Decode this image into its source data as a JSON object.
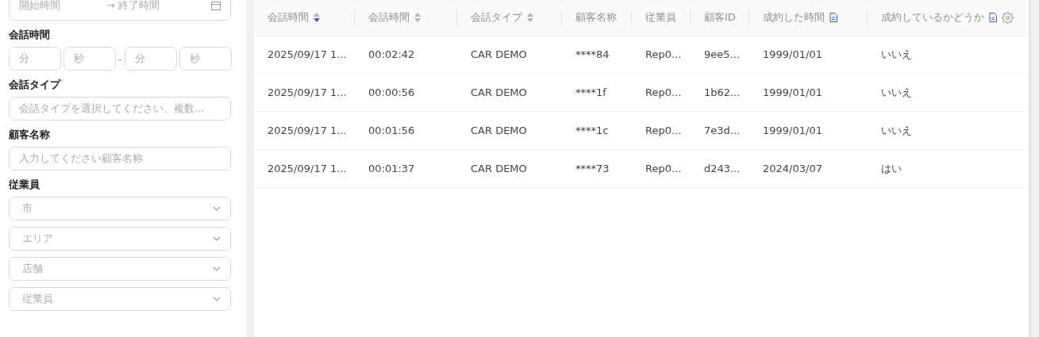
{
  "filters": [
    {
      "kind": "range",
      "start_placeholder": "開始時間",
      "end_placeholder": "終了時間",
      "separator": "→"
    },
    {
      "kind": "label",
      "text": "会話時間"
    },
    {
      "kind": "duration",
      "placeholders": [
        "分",
        "秒",
        "分",
        "秒"
      ],
      "separator": "-"
    },
    {
      "kind": "label",
      "text": "会話タイプ"
    },
    {
      "kind": "text",
      "placeholder": "会話タイプを選択してください、複数..."
    },
    {
      "kind": "label",
      "text": "顧客名称"
    },
    {
      "kind": "text",
      "placeholder": "入力してください顧客名称"
    },
    {
      "kind": "label",
      "text": "従業員"
    },
    {
      "kind": "select",
      "placeholder": "市"
    },
    {
      "kind": "select",
      "placeholder": "エリア"
    },
    {
      "kind": "select",
      "placeholder": "店舗"
    },
    {
      "kind": "select",
      "placeholder": "従業員"
    }
  ],
  "table": {
    "columns": [
      {
        "label": "会話時間",
        "kind": "sortable",
        "sorted_descending": true
      },
      {
        "label": "会話時間",
        "kind": "sortable",
        "sorted_descending": false
      },
      {
        "label": "会話タイプ",
        "kind": "sortable",
        "sorted_descending": false
      },
      {
        "label": "顧客名称",
        "kind": "plain"
      },
      {
        "label": "従業員",
        "kind": "plain"
      },
      {
        "label": "顧客ID",
        "kind": "plain"
      },
      {
        "label": "成約した時間",
        "kind": "note"
      },
      {
        "label": "成約しているかどうか",
        "kind": "note_settings"
      }
    ],
    "rows": [
      [
        "2025/09/17 1...",
        "00:02:42",
        "CAR DEMO",
        "****84",
        "Rep0...",
        "9ee5...",
        "1999/01/01",
        "いいえ"
      ],
      [
        "2025/09/17 1...",
        "00:00:56",
        "CAR DEMO",
        "****1f",
        "Rep0...",
        "1b62...",
        "1999/01/01",
        "いいえ"
      ],
      [
        "2025/09/17 1...",
        "00:01:56",
        "CAR DEMO",
        "****1c",
        "Rep0...",
        "7e3d...",
        "1999/01/01",
        "いいえ"
      ],
      [
        "2025/09/17 1...",
        "00:01:37",
        "CAR DEMO",
        "****73",
        "Rep0...",
        "d243...",
        "2024/03/07",
        "はい"
      ]
    ]
  }
}
